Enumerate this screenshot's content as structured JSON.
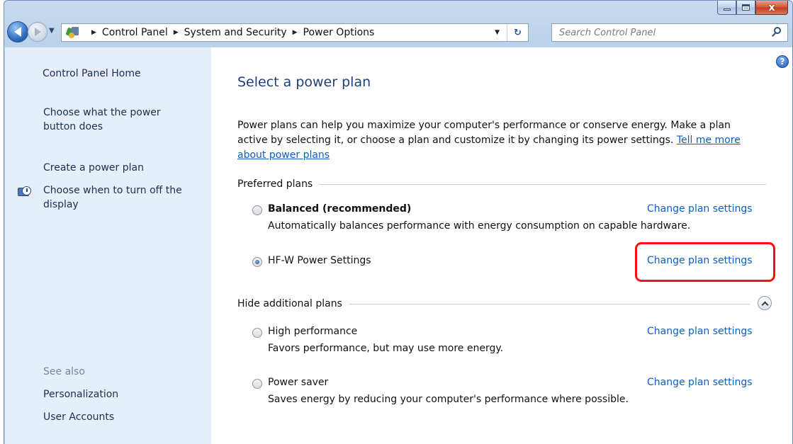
{
  "window": {
    "caption": {
      "minimize": "–",
      "maximize": "□",
      "close": "x"
    }
  },
  "address": {
    "breadcrumbs": [
      "Control Panel",
      "System and Security",
      "Power Options"
    ]
  },
  "search": {
    "placeholder": "Search Control Panel"
  },
  "sidebar": {
    "home": "Control Panel Home",
    "links": [
      "Choose what the power button does",
      "Create a power plan",
      "Choose when to turn off the display"
    ],
    "see_also": {
      "label": "See also",
      "links": [
        "Personalization",
        "User Accounts"
      ]
    }
  },
  "main": {
    "help": "?",
    "title": "Select a power plan",
    "intro": {
      "line1": "Power plans can help you maximize your computer's performance or conserve energy. Make a plan",
      "line2": "active by selecting it, or choose a plan and customize it by changing its power settings.",
      "link_part1": "Tell me more",
      "link_part2": "about power plans"
    },
    "preferred": {
      "heading": "Preferred plans",
      "plans": [
        {
          "name": "Balanced (recommended)",
          "description": "Automatically balances performance with energy consumption on capable hardware.",
          "selected": false,
          "link": "Change plan settings"
        },
        {
          "name": "HF-W Power Settings",
          "description": "",
          "selected": true,
          "link": "Change plan settings"
        }
      ]
    },
    "additional": {
      "heading": "Hide additional plans",
      "plans": [
        {
          "name": "High performance",
          "description": "Favors performance, but may use more energy.",
          "selected": false,
          "link": "Change plan settings"
        },
        {
          "name": "Power saver",
          "description": "Saves energy by reducing your computer's performance where possible.",
          "selected": false,
          "link": "Change plan settings"
        }
      ]
    }
  },
  "colors": {
    "link": "#0a5fc6",
    "title": "#1e3f7a",
    "sidebar_bg": "#e5eefa",
    "highlight": "#ff0d0d"
  }
}
